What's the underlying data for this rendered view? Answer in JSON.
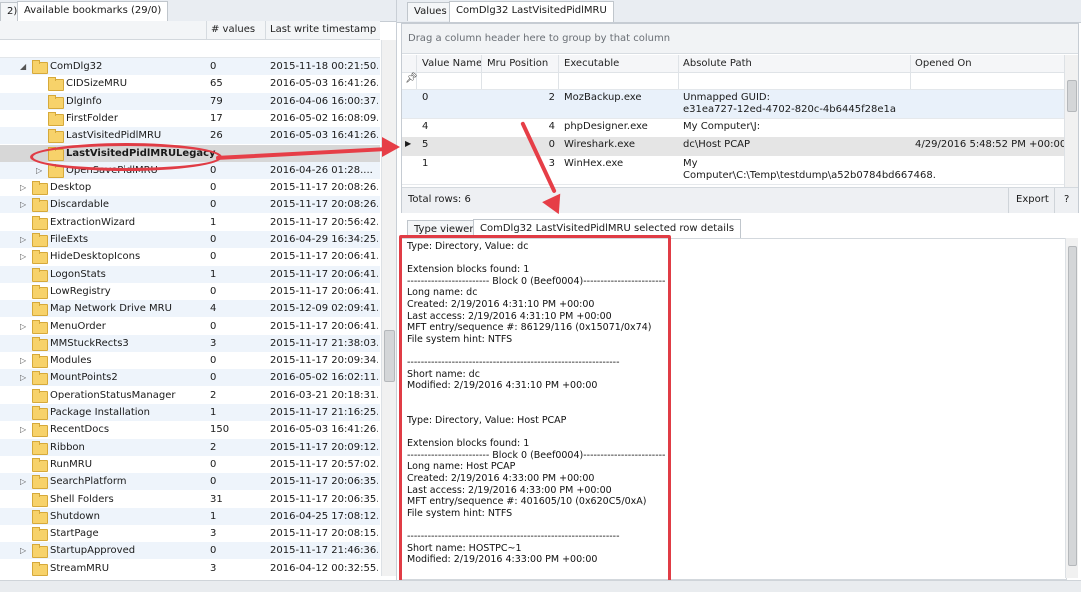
{
  "left": {
    "tabs": [
      "2)",
      "Available bookmarks (29/0)"
    ],
    "columns": [
      "# values",
      "Last write timestamp"
    ],
    "rows": [
      {
        "name": "ComDlg32",
        "values": "0",
        "ts": "2015-11-18 00:21:50....",
        "level": 1,
        "exp": "open"
      },
      {
        "name": "CIDSizeMRU",
        "values": "65",
        "ts": "2016-05-03 16:41:26....",
        "level": 2,
        "exp": ""
      },
      {
        "name": "DlgInfo",
        "values": "79",
        "ts": "2016-04-06 16:00:37....",
        "level": 2,
        "exp": ""
      },
      {
        "name": "FirstFolder",
        "values": "17",
        "ts": "2016-05-02 16:08:09....",
        "level": 2,
        "exp": ""
      },
      {
        "name": "LastVisitedPidlMRU",
        "values": "26",
        "ts": "2016-05-03 16:41:26....",
        "level": 2,
        "exp": ""
      },
      {
        "name": "LastVisitedPidlMRULegacy",
        "values": "",
        "ts": "",
        "level": 2,
        "exp": "",
        "selected": true
      },
      {
        "name": "OpenSavePidlMRU",
        "values": "0",
        "ts": "2016-04-26 01:28....",
        "level": 2,
        "exp": "closed"
      },
      {
        "name": "Desktop",
        "values": "0",
        "ts": "2015-11-17 20:08:26....",
        "level": 1,
        "exp": "closed"
      },
      {
        "name": "Discardable",
        "values": "0",
        "ts": "2015-11-17 20:08:26....",
        "level": 1,
        "exp": "closed"
      },
      {
        "name": "ExtractionWizard",
        "values": "1",
        "ts": "2015-11-17 20:56:42....",
        "level": 1,
        "exp": ""
      },
      {
        "name": "FileExts",
        "values": "0",
        "ts": "2016-04-29 16:34:25....",
        "level": 1,
        "exp": "closed"
      },
      {
        "name": "HideDesktopIcons",
        "values": "0",
        "ts": "2015-11-17 20:06:41....",
        "level": 1,
        "exp": "closed"
      },
      {
        "name": "LogonStats",
        "values": "1",
        "ts": "2015-11-17 20:06:41....",
        "level": 1,
        "exp": ""
      },
      {
        "name": "LowRegistry",
        "values": "0",
        "ts": "2015-11-17 20:06:41....",
        "level": 1,
        "exp": ""
      },
      {
        "name": "Map Network Drive MRU",
        "values": "4",
        "ts": "2015-12-09 02:09:41....",
        "level": 1,
        "exp": ""
      },
      {
        "name": "MenuOrder",
        "values": "0",
        "ts": "2015-11-17 20:06:41....",
        "level": 1,
        "exp": "closed"
      },
      {
        "name": "MMStuckRects3",
        "values": "3",
        "ts": "2015-11-17 21:38:03....",
        "level": 1,
        "exp": ""
      },
      {
        "name": "Modules",
        "values": "0",
        "ts": "2015-11-17 20:09:34....",
        "level": 1,
        "exp": "closed"
      },
      {
        "name": "MountPoints2",
        "values": "0",
        "ts": "2016-05-02 16:02:11....",
        "level": 1,
        "exp": "closed"
      },
      {
        "name": "OperationStatusManager",
        "values": "2",
        "ts": "2016-03-21 20:18:31....",
        "level": 1,
        "exp": ""
      },
      {
        "name": "Package Installation",
        "values": "1",
        "ts": "2015-11-17 21:16:25....",
        "level": 1,
        "exp": ""
      },
      {
        "name": "RecentDocs",
        "values": "150",
        "ts": "2016-05-03 16:41:26....",
        "level": 1,
        "exp": "closed"
      },
      {
        "name": "Ribbon",
        "values": "2",
        "ts": "2015-11-17 20:09:12....",
        "level": 1,
        "exp": ""
      },
      {
        "name": "RunMRU",
        "values": "0",
        "ts": "2015-11-17 20:57:02....",
        "level": 1,
        "exp": ""
      },
      {
        "name": "SearchPlatform",
        "values": "0",
        "ts": "2015-11-17 20:06:35....",
        "level": 1,
        "exp": "closed"
      },
      {
        "name": "Shell Folders",
        "values": "31",
        "ts": "2015-11-17 20:06:35....",
        "level": 1,
        "exp": ""
      },
      {
        "name": "Shutdown",
        "values": "1",
        "ts": "2016-04-25 17:08:12....",
        "level": 1,
        "exp": ""
      },
      {
        "name": "StartPage",
        "values": "3",
        "ts": "2015-11-17 20:08:15....",
        "level": 1,
        "exp": ""
      },
      {
        "name": "StartupApproved",
        "values": "0",
        "ts": "2015-11-17 21:46:36....",
        "level": 1,
        "exp": "closed"
      },
      {
        "name": "StreamMRU",
        "values": "3",
        "ts": "2016-04-12 00:32:55....",
        "level": 1,
        "exp": ""
      }
    ]
  },
  "right": {
    "tabs": [
      "Values",
      "ComDlg32 LastVisitedPidlMRU"
    ],
    "group_hint": "Drag a column header here to group by that column",
    "columns": [
      "Value Name",
      "Mru Position",
      "Executable",
      "Absolute Path",
      "Opened On"
    ],
    "rows": [
      {
        "value_name": "0",
        "mru": "2",
        "exe": "MozBackup.exe",
        "path": "Unmapped GUID:",
        "path2": "e31ea727-12ed-4702-820c-4b6445f28e1a",
        "opened": ""
      },
      {
        "value_name": "4",
        "mru": "4",
        "exe": "phpDesigner.exe",
        "path": "My Computer\\J:",
        "path2": "",
        "opened": ""
      },
      {
        "value_name": "5",
        "mru": "0",
        "exe": "Wireshark.exe",
        "path": "dc\\Host PCAP",
        "path2": "",
        "opened": "4/29/2016 5:48:52 PM +00:00"
      },
      {
        "value_name": "1",
        "mru": "3",
        "exe": "WinHex.exe",
        "path": "My",
        "path2": "Computer\\C:\\Temp\\testdump\\a52b0784bd667468.",
        "opened": ""
      }
    ],
    "total_rows": "Total rows: 6",
    "export_label": "Export",
    "help_label": "?",
    "lower_tabs": [
      "Type viewer",
      "ComDlg32 LastVisitedPidlMRU selected row details"
    ],
    "details": [
      "Type: Directory, Value: dc",
      "",
      "Extension blocks found: 1",
      "------------------------ Block 0 (Beef0004)------------------------",
      "Long name: dc",
      "Created: 2/19/2016 4:31:10 PM +00:00",
      "Last access: 2/19/2016 4:31:10 PM +00:00",
      "MFT entry/sequence #: 86129/116 (0x15071/0x74)",
      "File system hint: NTFS",
      "",
      "--------------------------------------------------------------",
      "Short name: dc",
      "Modified: 2/19/2016 4:31:10 PM +00:00",
      "",
      "",
      "Type: Directory, Value: Host PCAP",
      "",
      "Extension blocks found: 1",
      "------------------------ Block 0 (Beef0004)------------------------",
      "Long name: Host PCAP",
      "Created: 2/19/2016 4:33:00 PM +00:00",
      "Last access: 2/19/2016 4:33:00 PM +00:00",
      "MFT entry/sequence #: 401605/10 (0x620C5/0xA)",
      "File system hint: NTFS",
      "",
      "--------------------------------------------------------------",
      "Short name: HOSTPC~1",
      "Modified: 2/19/2016 4:33:00 PM +00:00"
    ]
  },
  "colors": {
    "annotation": "#e03c45",
    "selected_row": "#d7d7d7",
    "alt_row": "#eef4fb",
    "folder": "#f7d26a"
  }
}
